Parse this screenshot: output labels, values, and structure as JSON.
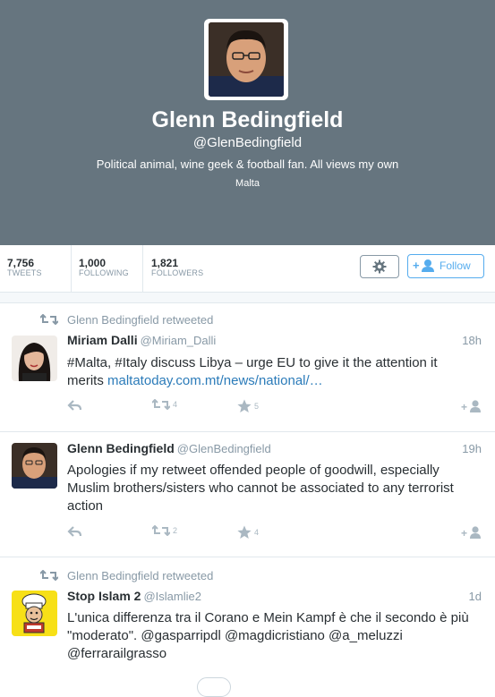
{
  "profile": {
    "name": "Glenn Bedingfield",
    "handle": "@GlenBedingfield",
    "bio": "Political animal, wine geek & football fan. All views my own",
    "location": "Malta"
  },
  "stats": [
    {
      "value": "7,756",
      "label": "TWEETS"
    },
    {
      "value": "1,000",
      "label": "FOLLOWING"
    },
    {
      "value": "1,821",
      "label": "FOLLOWERS"
    }
  ],
  "actions": {
    "follow_label": "Follow",
    "settings_icon": "gear-icon"
  },
  "colors": {
    "header_bg": "#66757f",
    "accent": "#55acee",
    "link": "#2b7bb9",
    "muted": "#8899a6"
  },
  "tweets": [
    {
      "retweeted_by": "Glenn Bedingfield retweeted",
      "name": "Miriam Dalli",
      "handle": "@Miriam_Dalli",
      "time": "18h",
      "text": "#Malta, #Italy discuss Libya – urge EU to give it the attention it merits ",
      "link": "maltatoday.com.mt/news/national/…",
      "retweets": "4",
      "favorites": "5"
    },
    {
      "retweeted_by": "",
      "name": "Glenn Bedingfield",
      "handle": "@GlenBedingfield",
      "time": "19h",
      "text": "Apologies if my retweet offended people of goodwill, especially Muslim brothers/sisters who cannot be associated to any terrorist action",
      "link": "",
      "retweets": "2",
      "favorites": "4"
    },
    {
      "retweeted_by": "Glenn Bedingfield retweeted",
      "name": "Stop Islam 2",
      "handle": "@Islamlie2",
      "time": "1d",
      "text": "L'unica differenza tra il Corano e Mein Kampf è che il secondo è più \"moderato\". @gasparripdl @magdicristiano @a_meluzzi @ferrarailgrasso",
      "link": "",
      "retweets": "",
      "favorites": ""
    }
  ]
}
